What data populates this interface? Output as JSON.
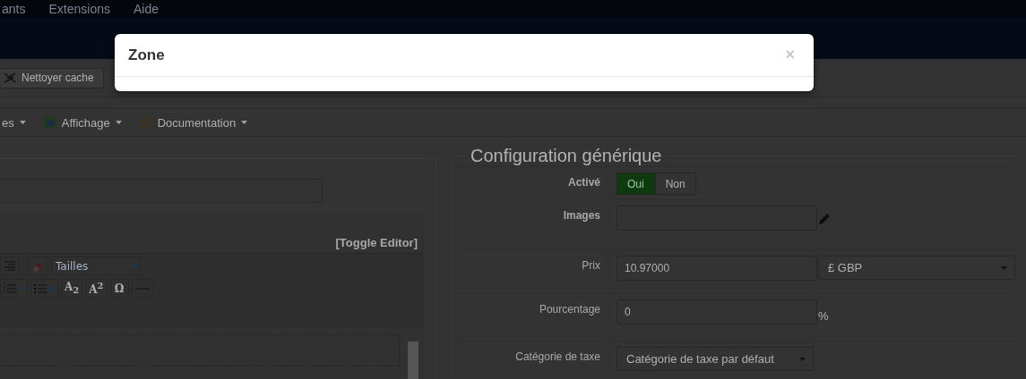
{
  "top_menu": [
    {
      "label": "ants"
    },
    {
      "label": "Extensions"
    },
    {
      "label": "Aide"
    }
  ],
  "toolbar": {
    "buttons": [
      {
        "label": "Nettoyer cache"
      }
    ]
  },
  "submenu": [
    {
      "label": "es",
      "kind": "plain"
    },
    {
      "label": "Affichage",
      "kind": "screen"
    },
    {
      "label": "Documentation",
      "kind": "help"
    }
  ],
  "editor": {
    "toggle": "[Toggle Editor]",
    "size_select": "Tailles",
    "tools": [
      {
        "kind": "numbered"
      },
      {
        "kind": "bullets"
      },
      {
        "kind": "text",
        "label": "A$_{2}$"
      },
      {
        "kind": "text",
        "label": "A$^{2}$"
      },
      {
        "kind": "text",
        "label": "Ω"
      },
      {
        "kind": "rule"
      }
    ]
  },
  "config": {
    "legend": "Configuration générique",
    "fields": [
      {
        "kind": "toggle",
        "label": "Activé",
        "options": [
          {
            "label": "Oui",
            "selected": true
          },
          {
            "label": "Non",
            "selected": false
          }
        ]
      },
      {
        "kind": "image",
        "label": "Images"
      },
      {
        "kind": "price",
        "label": "Prix",
        "value": "10.97000",
        "currency": "£ GBP"
      },
      {
        "kind": "percent",
        "label": "Pourcentage",
        "value": "0",
        "suffix": "%"
      },
      {
        "kind": "select",
        "label": "Catégorie de taxe",
        "value": "Catégorie de taxe par défaut"
      }
    ]
  },
  "modal": {
    "title": "Zone",
    "close": "×"
  }
}
